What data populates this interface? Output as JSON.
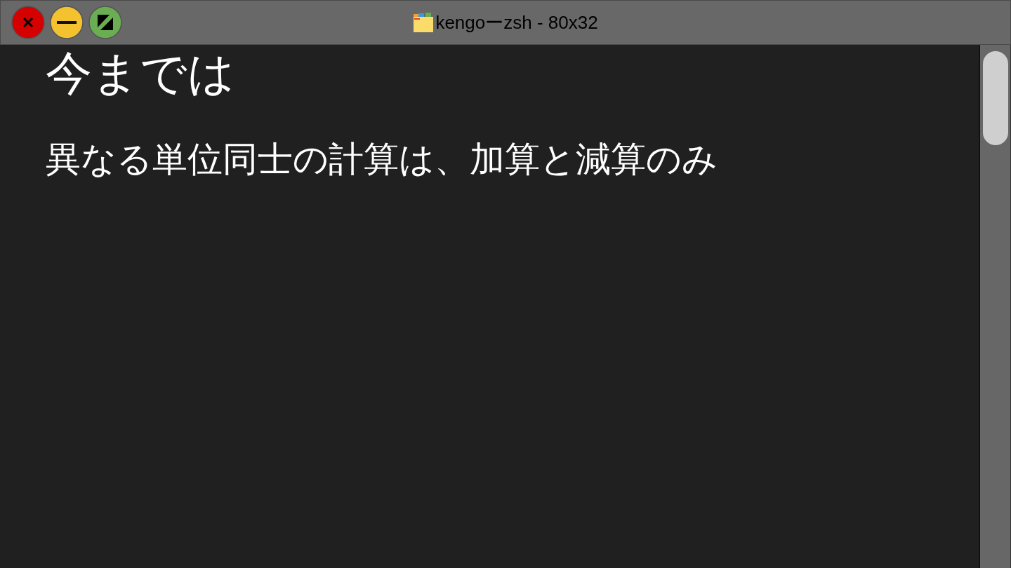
{
  "window": {
    "title": "kengoーzsh - 80x32"
  },
  "content": {
    "heading": "今までは",
    "lines": [
      "異なる単位同士の計算は、加算と減算のみ"
    ]
  }
}
